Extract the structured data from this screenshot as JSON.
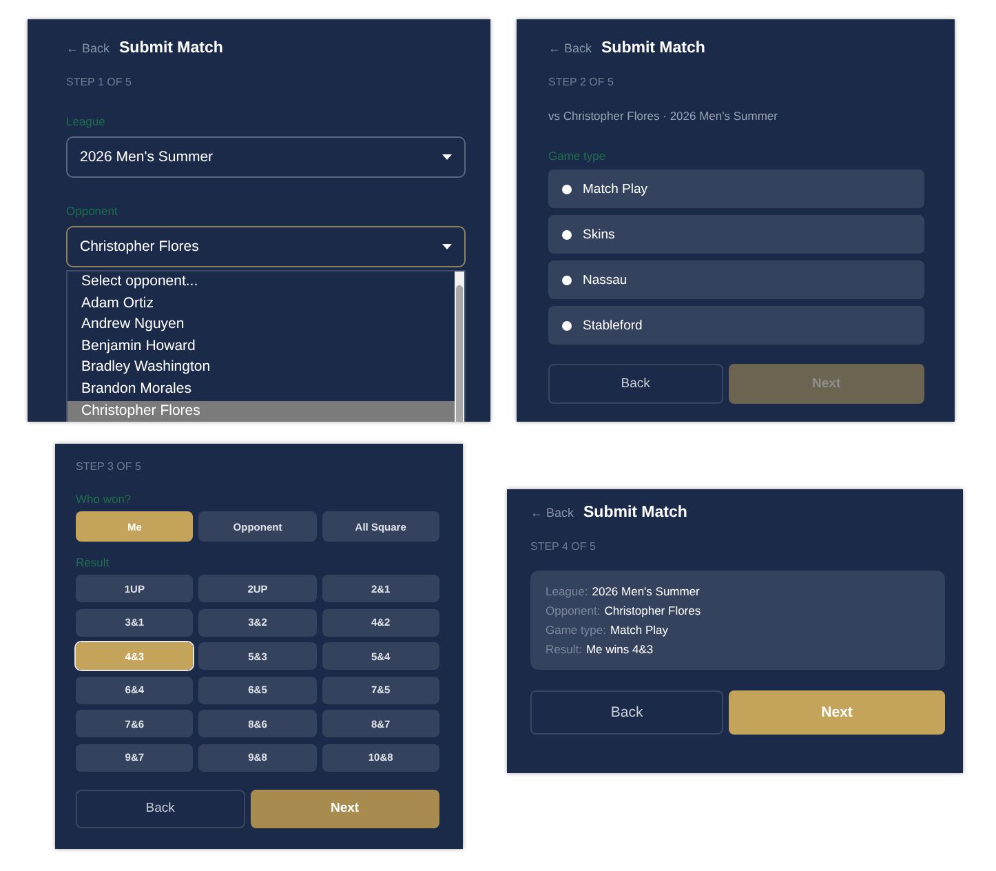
{
  "screens": [
    {
      "kind": "opponent",
      "header": {
        "back": "← Back",
        "title": "Submit Match"
      },
      "step": "STEP 1 OF 5",
      "league": {
        "label": "League",
        "value": "2026 Men's Summer"
      },
      "opponent": {
        "label": "Opponent",
        "value": "Christopher Flores",
        "expanded": true
      },
      "options": [
        {
          "label": "Select opponent...",
          "selected": false
        },
        {
          "label": "Adam Ortiz",
          "selected": false
        },
        {
          "label": "Andrew Nguyen",
          "selected": false
        },
        {
          "label": "Benjamin Howard",
          "selected": false
        },
        {
          "label": "Bradley Washington",
          "selected": false
        },
        {
          "label": "Brandon Morales",
          "selected": false
        },
        {
          "label": "Christopher Flores",
          "selected": true
        }
      ]
    },
    {
      "kind": "game_type",
      "header": {
        "back": "← Back",
        "title": "Submit Match"
      },
      "step": "STEP 2 OF 5",
      "subtitle": "vs Christopher Flores · 2026 Men's Summer",
      "label": "Game type",
      "choices": [
        {
          "label": "Match Play",
          "selected": false
        },
        {
          "label": "Skins",
          "selected": false
        },
        {
          "label": "Nassau",
          "selected": false
        },
        {
          "label": "Stableford",
          "selected": false
        }
      ],
      "back": "Back",
      "next": "Next",
      "next_disabled": true
    },
    {
      "kind": "result",
      "step": "STEP 3 OF 5",
      "winner_label": "Who won?",
      "winners": [
        {
          "label": "Me",
          "selected": true
        },
        {
          "label": "Opponent",
          "selected": false
        },
        {
          "label": "All Square",
          "selected": false
        }
      ],
      "result_label": "Result",
      "results": [
        {
          "label": "1UP",
          "selected": false
        },
        {
          "label": "2UP",
          "selected": false
        },
        {
          "label": "2&1",
          "selected": false
        },
        {
          "label": "3&1",
          "selected": false
        },
        {
          "label": "3&2",
          "selected": false
        },
        {
          "label": "4&2",
          "selected": false
        },
        {
          "label": "4&3",
          "selected": true
        },
        {
          "label": "5&3",
          "selected": false
        },
        {
          "label": "5&4",
          "selected": false
        },
        {
          "label": "6&4",
          "selected": false
        },
        {
          "label": "6&5",
          "selected": false
        },
        {
          "label": "7&5",
          "selected": false
        },
        {
          "label": "7&6",
          "selected": false
        },
        {
          "label": "8&6",
          "selected": false
        },
        {
          "label": "8&7",
          "selected": false
        },
        {
          "label": "9&7",
          "selected": false
        },
        {
          "label": "9&8",
          "selected": false
        },
        {
          "label": "10&8",
          "selected": false
        }
      ],
      "back": "Back",
      "next": "Next",
      "next_disabled": false
    },
    {
      "kind": "review",
      "header": {
        "back": "← Back",
        "title": "Submit Match"
      },
      "step": "STEP 4 OF 5",
      "summary": [
        {
          "label": "League:",
          "value": "2026 Men's Summer"
        },
        {
          "label": "Opponent:",
          "value": "Christopher Flores"
        },
        {
          "label": "Game type:",
          "value": "Match Play"
        },
        {
          "label": "Result:",
          "value": "Me wins 4&3"
        }
      ],
      "back": "Back",
      "next": "Next",
      "next_disabled": false
    }
  ]
}
